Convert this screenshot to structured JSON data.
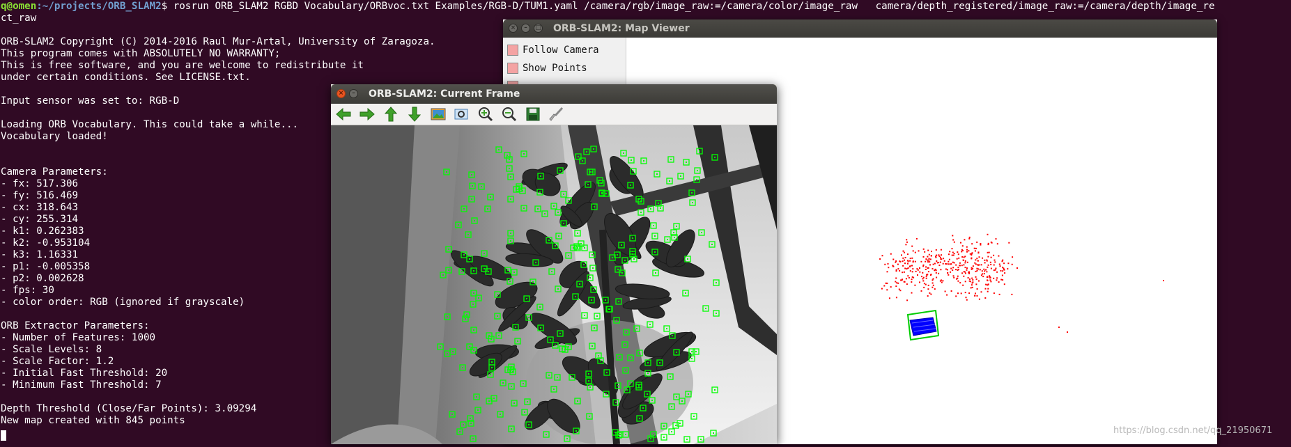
{
  "terminal": {
    "prompt_user": "q@omen",
    "prompt_path": ":~/projects/ORB_SLAM2",
    "prompt_symbol": "$",
    "command": " rosrun ORB_SLAM2 RGBD Vocabulary/ORBvoc.txt Examples/RGB-D/TUM1.yaml /camera/rgb/image_raw:=/camera/color/image_raw   camera/depth_registered/image_raw:=/camera/depth/image_re",
    "command_wrap": "ct_raw",
    "lines": [
      "",
      "ORB-SLAM2 Copyright (C) 2014-2016 Raul Mur-Artal, University of Zaragoza.",
      "This program comes with ABSOLUTELY NO WARRANTY;",
      "This is free software, and you are welcome to redistribute it",
      "under certain conditions. See LICENSE.txt.",
      "",
      "Input sensor was set to: RGB-D",
      "",
      "Loading ORB Vocabulary. This could take a while...",
      "Vocabulary loaded!",
      "",
      "",
      "Camera Parameters: ",
      "- fx: 517.306",
      "- fy: 516.469",
      "- cx: 318.643",
      "- cy: 255.314",
      "- k1: 0.262383",
      "- k2: -0.953104",
      "- k3: 1.16331",
      "- p1: -0.005358",
      "- p2: 0.002628",
      "- fps: 30",
      "- color order: RGB (ignored if grayscale)",
      "",
      "ORB Extractor Parameters: ",
      "- Number of Features: 1000",
      "- Scale Levels: 8",
      "- Scale Factor: 1.2",
      "- Initial Fast Threshold: 20",
      "- Minimum Fast Threshold: 7",
      "",
      "Depth Threshold (Close/Far Points): 3.09294",
      "New map created with 845 points"
    ]
  },
  "map_viewer": {
    "title": "ORB-SLAM2: Map Viewer",
    "menu": [
      {
        "label": "Follow Camera"
      },
      {
        "label": "Show Points"
      }
    ]
  },
  "current_frame": {
    "title": "ORB-SLAM2: Current Frame",
    "toolbar": [
      "back-arrow-icon",
      "forward-arrow-icon",
      "up-arrow-icon",
      "down-arrow-icon",
      "image-icon",
      "zoom-fit-icon",
      "zoom-in-icon",
      "zoom-out-icon",
      "save-icon",
      "brush-icon"
    ]
  },
  "colors": {
    "terminal_bg": "#300a24",
    "map_points": "#ff0000",
    "keyframes": "#0000ff",
    "current_camera": "#00cc00",
    "features": "#00ff00"
  },
  "watermark": "https://blog.csdn.net/qq_21950671"
}
